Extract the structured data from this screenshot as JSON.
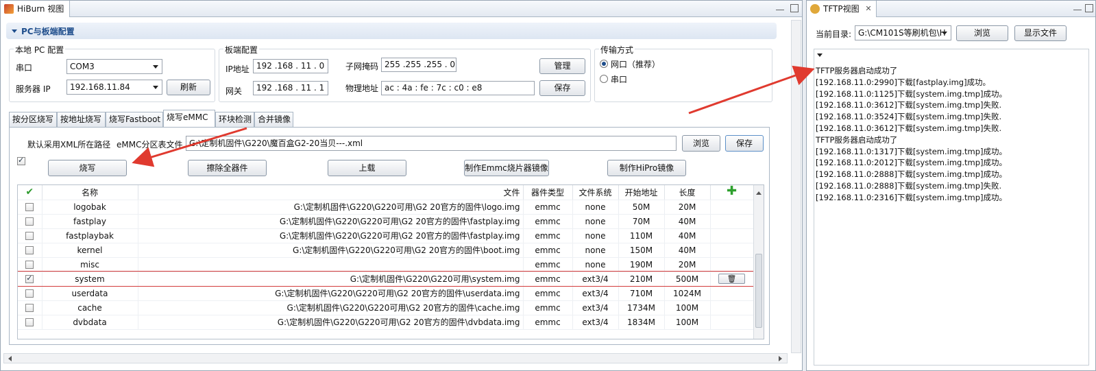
{
  "hiburn": {
    "tab_title": "HiBurn 视图",
    "section_title": "PC与板端配置",
    "local_pc": {
      "group_title": "本地 PC 配置",
      "port_label": "串口",
      "port_value": "COM3",
      "server_ip_label": "服务器 IP",
      "server_ip_value": "192.168.11.84",
      "refresh_label": "刷新"
    },
    "board": {
      "group_title": "板端配置",
      "ip_label": "IP地址",
      "ip_value": "192 .168 . 11 . 0",
      "gateway_label": "网关",
      "gateway_value": "192 .168 . 11 . 1",
      "mask_label": "子网掩码",
      "mask_value": "255 .255 .255 . 0",
      "mac_label": "物理地址",
      "mac_value": "ac : 4a : fe : 7c : c0 : e8",
      "manage_label": "管理",
      "save_label": "保存"
    },
    "transport": {
      "group_title": "传输方式",
      "network_label": "网口（推荐）",
      "serial_label": "串口",
      "selected": "网口（推荐）"
    },
    "burn_tabs": [
      "按分区烧写",
      "按地址烧写",
      "烧写Fastboot",
      "烧写eMMC",
      "环块检测",
      "合并镜像"
    ],
    "active_burn_tab": "烧写eMMC",
    "xml": {
      "default_label": "默认采用XML所在路径",
      "table_label": "eMMC分区表文件",
      "path": "G:\\定制机固件\\G220\\魔百盒G2-20当贝---.xml",
      "browse_label": "浏览",
      "save_label": "保存"
    },
    "actions": [
      "烧写",
      "擦除全器件",
      "上载",
      "制作Emmc烧片器镜像",
      "制作HiPro镜像"
    ],
    "table": {
      "headers": [
        "名称",
        "文件",
        "器件类型",
        "文件系统",
        "开始地址",
        "长度"
      ],
      "rows": [
        {
          "checked": false,
          "name": "logobak",
          "file": "G:\\定制机固件\\G220\\G220可用\\G2 20官方的固件\\logo.img",
          "type": "emmc",
          "fs": "none",
          "start": "50M",
          "len": "20M"
        },
        {
          "checked": false,
          "name": "fastplay",
          "file": "G:\\定制机固件\\G220\\G220可用\\G2 20官方的固件\\fastplay.img",
          "type": "emmc",
          "fs": "none",
          "start": "70M",
          "len": "40M"
        },
        {
          "checked": false,
          "name": "fastplaybak",
          "file": "G:\\定制机固件\\G220\\G220可用\\G2 20官方的固件\\fastplay.img",
          "type": "emmc",
          "fs": "none",
          "start": "110M",
          "len": "40M"
        },
        {
          "checked": false,
          "name": "kernel",
          "file": "G:\\定制机固件\\G220\\G220可用\\G2 20官方的固件\\boot.img",
          "type": "emmc",
          "fs": "none",
          "start": "150M",
          "len": "40M"
        },
        {
          "checked": false,
          "name": "misc",
          "file": "",
          "type": "emmc",
          "fs": "none",
          "start": "190M",
          "len": "20M"
        },
        {
          "checked": true,
          "name": "system",
          "file": "G:\\定制机固件\\G220\\G220可用\\system.img",
          "type": "emmc",
          "fs": "ext3/4",
          "start": "210M",
          "len": "500M"
        },
        {
          "checked": false,
          "name": "userdata",
          "file": "G:\\定制机固件\\G220\\G220可用\\G2 20官方的固件\\userdata.img",
          "type": "emmc",
          "fs": "ext3/4",
          "start": "710M",
          "len": "1024M"
        },
        {
          "checked": false,
          "name": "cache",
          "file": "G:\\定制机固件\\G220\\G220可用\\G2 20官方的固件\\cache.img",
          "type": "emmc",
          "fs": "ext3/4",
          "start": "1734M",
          "len": "100M"
        },
        {
          "checked": false,
          "name": "dvbdata",
          "file": "G:\\定制机固件\\G220\\G220可用\\G2 20官方的固件\\dvbdata.img",
          "type": "emmc",
          "fs": "ext3/4",
          "start": "1834M",
          "len": "100M"
        }
      ]
    }
  },
  "tftp": {
    "tab_title": "TFTP视图",
    "dir_label": "当前目录:",
    "dir_value": "G:\\CM101S等刷机包\\H",
    "browse_label": "浏览",
    "show_files_label": "显示文件",
    "log": [
      "TFTP服务器启动成功了",
      "[192.168.11.0:2990]下载[fastplay.img]成功。",
      "[192.168.11.0:1125]下载[system.img.tmp]成功。",
      "[192.168.11.0:3612]下载[system.img.tmp]失败.",
      "[192.168.11.0:3524]下载[system.img.tmp]失败.",
      "[192.168.11.0:3612]下载[system.img.tmp]失败.",
      "TFTP服务器启动成功了",
      "[192.168.11.0:1317]下载[system.img.tmp]成功。",
      "[192.168.11.0:2012]下载[system.img.tmp]成功。",
      "[192.168.11.0:2888]下载[system.img.tmp]成功。",
      "[192.168.11.0:2888]下载[system.img.tmp]失败.",
      "[192.168.11.0:2316]下载[system.img.tmp]成功。"
    ]
  },
  "colors": {
    "accent": "#1f4e8c",
    "annotation_arrow": "#e03a2f",
    "selected_row_border": "#d23a3a"
  }
}
